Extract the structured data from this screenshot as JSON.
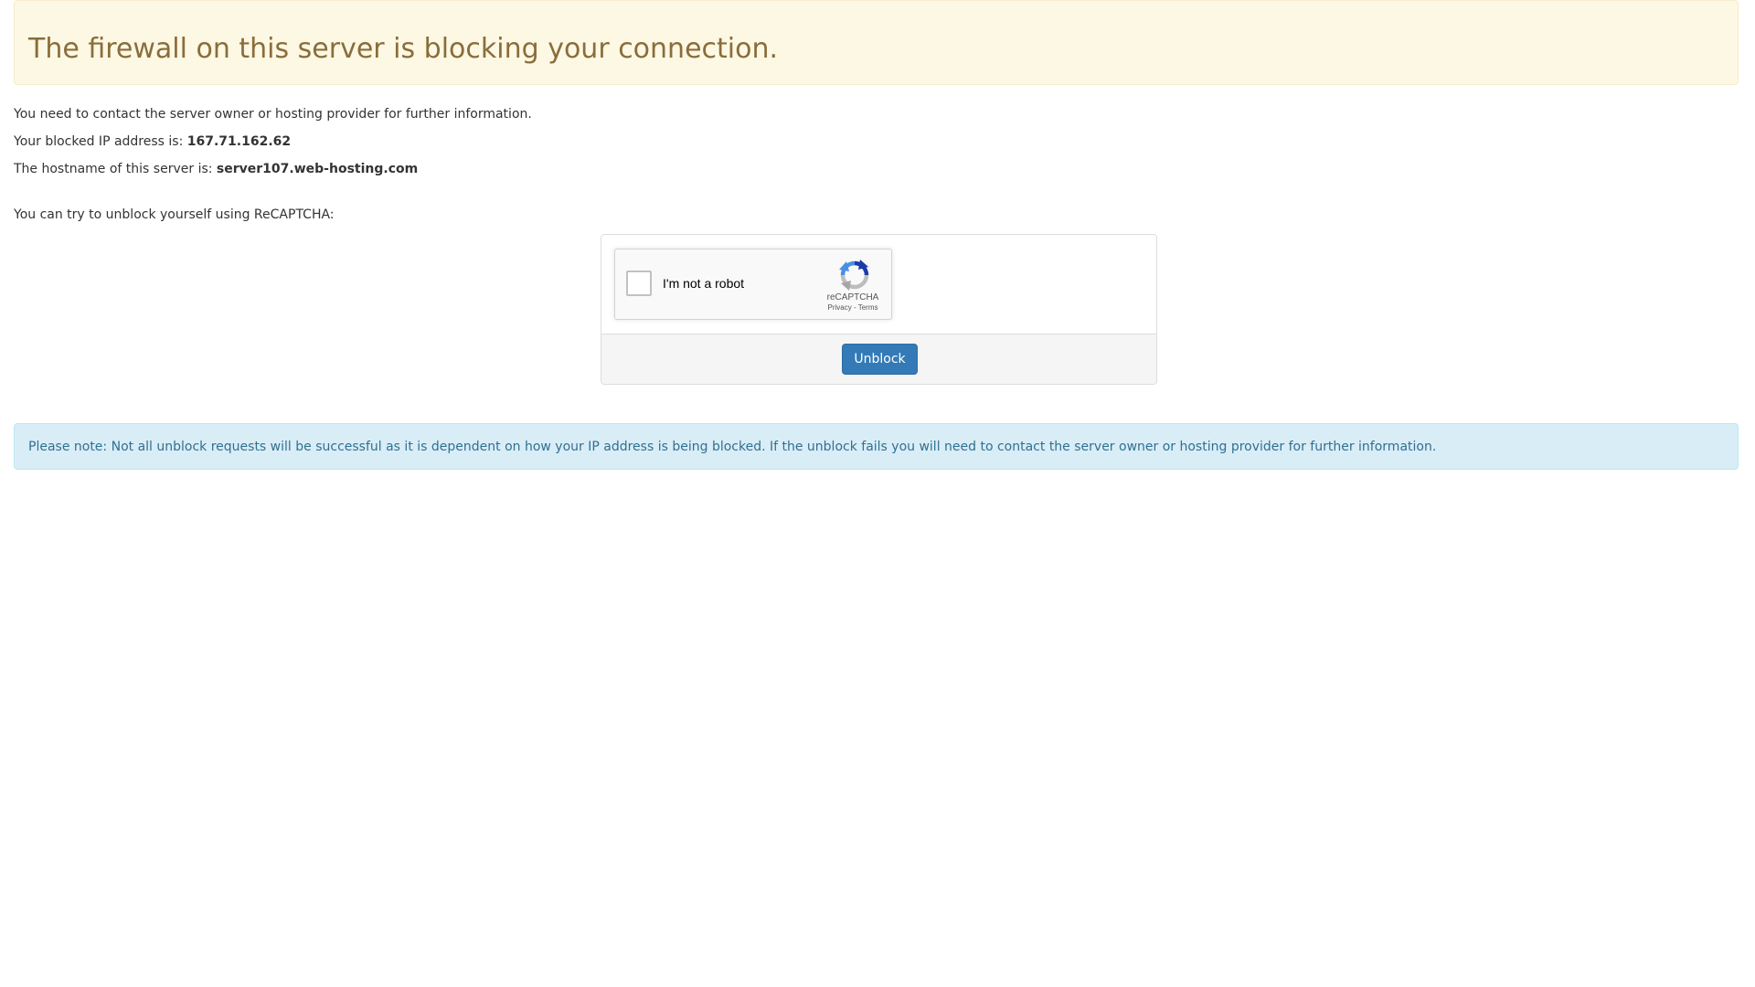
{
  "alert": {
    "title": "The firewall on this server is blocking your connection."
  },
  "info": {
    "contact_text": "You need to contact the server owner or hosting provider for further information.",
    "ip_label": "Your blocked IP address is: ",
    "ip_value": "167.71.162.62",
    "hostname_label": "The hostname of this server is: ",
    "hostname_value": "server107.web-hosting.com",
    "recaptcha_prompt": "You can try to unblock yourself using ReCAPTCHA:"
  },
  "recaptcha": {
    "label": "I'm not a robot",
    "brand": "reCAPTCHA",
    "privacy": "Privacy",
    "separator": " - ",
    "terms": "Terms",
    "checked": false
  },
  "form": {
    "unblock_label": "Unblock"
  },
  "note": {
    "text": "Please note: Not all unblock requests will be successful as it is dependent on how your IP address is being blocked. If the unblock fails you will need to contact the server owner or hosting provider for further information."
  },
  "colors": {
    "warning_bg": "#fcf8e3",
    "warning_text": "#8a6d3b",
    "info_bg": "#d9edf7",
    "info_text": "#31708f",
    "primary_button": "#337ab7"
  }
}
